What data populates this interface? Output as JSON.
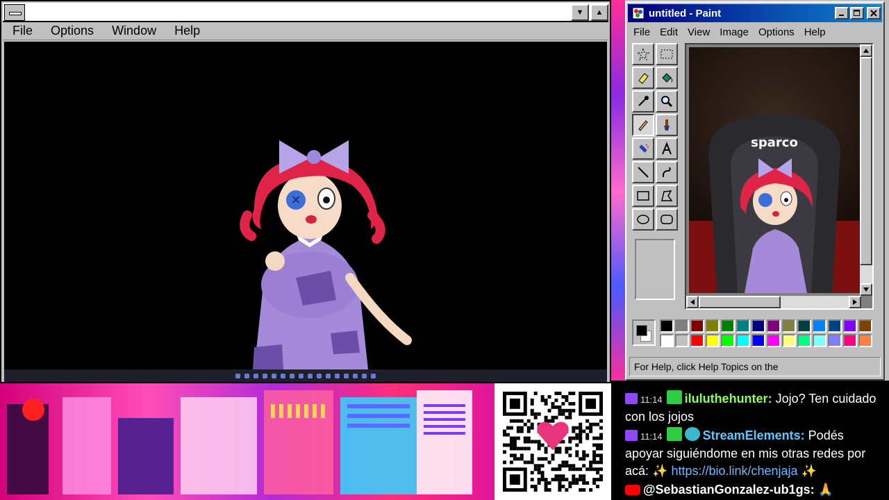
{
  "left_window": {
    "menu": [
      "File",
      "Options",
      "Window",
      "Help"
    ],
    "min_glyph": "▼",
    "max_glyph": "▲"
  },
  "paint": {
    "title": "untitled - Paint",
    "menu": [
      "File",
      "Edit",
      "View",
      "Image",
      "Options",
      "Help"
    ],
    "status": "For Help, click Help Topics on the",
    "canvas_text": "sparco",
    "palette_top": [
      "#000000",
      "#808080",
      "#800000",
      "#808000",
      "#008000",
      "#008080",
      "#000080",
      "#800080",
      "#808040",
      "#004040",
      "#0080ff",
      "#004080",
      "#8000ff",
      "#804000"
    ],
    "palette_bottom": [
      "#ffffff",
      "#c0c0c0",
      "#ff0000",
      "#ffff00",
      "#00ff00",
      "#00ffff",
      "#0000ff",
      "#ff00ff",
      "#ffff80",
      "#00ff80",
      "#80ffff",
      "#8080ff",
      "#ff0080",
      "#ff8040"
    ],
    "fg_color": "#000000",
    "bg_color": "#ffffff"
  },
  "chat": {
    "messages": [
      {
        "platform": "twitch",
        "time": "11:14",
        "user": "iluluthehunter",
        "text": "Jojo? Ten cuidado con los jojos"
      },
      {
        "platform": "twitch",
        "time": "11:14",
        "user": "StreamElements",
        "text": "Podés apoyar siguiéndome en mis otras redes por acá: ✨",
        "link": "https://bio.link/chenjaja",
        "tail": "✨"
      },
      {
        "platform": "youtube",
        "user": "@SebastianGonzalez-ub1gs:",
        "text": "🙏"
      }
    ]
  }
}
